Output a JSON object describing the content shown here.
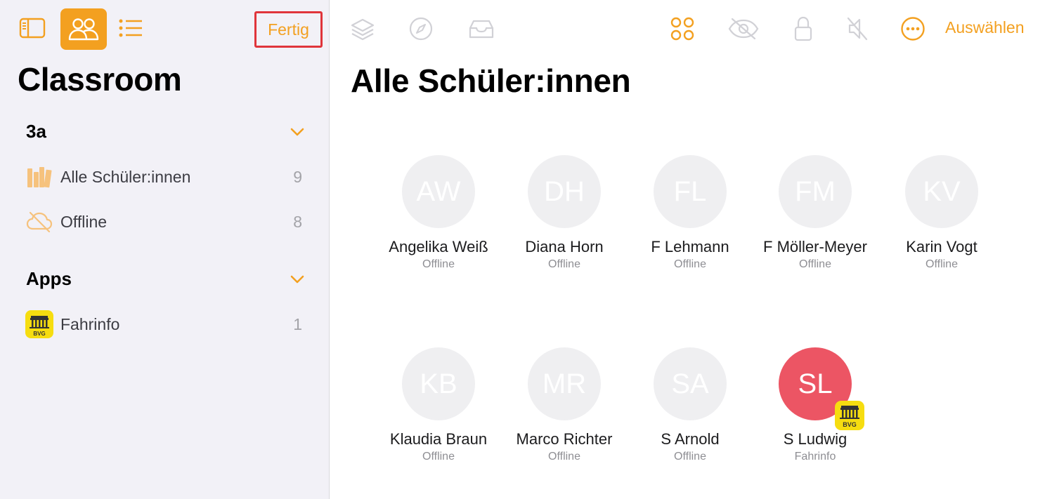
{
  "sidebar": {
    "title": "Classroom",
    "toolbar": {
      "done_label": "Fertig"
    },
    "sections": [
      {
        "title": "3a",
        "items": [
          {
            "label": "Alle Schüler:innen",
            "count": "9",
            "icon": "books-icon"
          },
          {
            "label": "Offline",
            "count": "8",
            "icon": "cloud-offline-icon"
          }
        ]
      },
      {
        "title": "Apps",
        "items": [
          {
            "label": "Fahrinfo",
            "count": "1",
            "icon": "bvg-app-icon",
            "app_badge": "BVG"
          }
        ]
      }
    ]
  },
  "main": {
    "title": "Alle Schüler:innen",
    "toolbar": {
      "select_label": "Auswählen",
      "icons": [
        "layers-icon",
        "compass-icon",
        "tray-icon",
        "apps-grid-icon",
        "eye-slash-icon",
        "lock-icon",
        "mute-icon",
        "more-icon"
      ]
    },
    "students": [
      {
        "initials": "AW",
        "name": "Angelika Weiß",
        "status": "Offline"
      },
      {
        "initials": "DH",
        "name": "Diana Horn",
        "status": "Offline"
      },
      {
        "initials": "FL",
        "name": "F Lehmann",
        "status": "Offline"
      },
      {
        "initials": "FM",
        "name": "F Möller-Meyer",
        "status": "Offline"
      },
      {
        "initials": "KV",
        "name": "Karin Vogt",
        "status": "Offline"
      },
      {
        "initials": "KB",
        "name": "Klaudia Braun",
        "status": "Offline"
      },
      {
        "initials": "MR",
        "name": "Marco Richter",
        "status": "Offline"
      },
      {
        "initials": "SA",
        "name": "S Arnold",
        "status": "Offline"
      },
      {
        "initials": "SL",
        "name": "S Ludwig",
        "status": "Fahrinfo",
        "active": true,
        "app_badge": "BVG"
      }
    ]
  },
  "colors": {
    "accent": "#f3a020",
    "active_avatar": "#ec5564",
    "highlight_border": "#e0353b",
    "bvg_yellow": "#f6dd10"
  }
}
